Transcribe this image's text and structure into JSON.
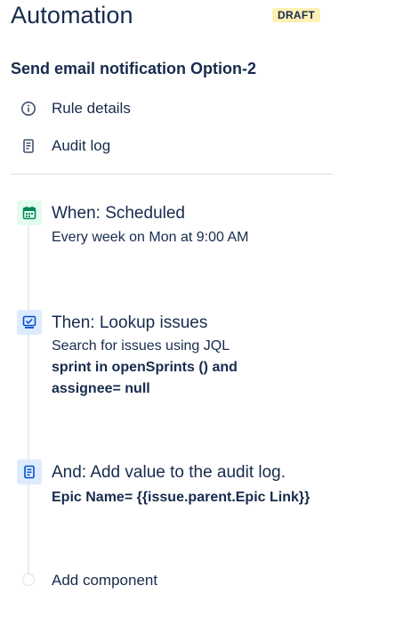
{
  "header": {
    "title": "Automation",
    "badge": "DRAFT"
  },
  "rule": {
    "name": "Send email notification Option-2"
  },
  "menu": {
    "rule_details": "Rule details",
    "audit_log": "Audit log"
  },
  "steps": [
    {
      "title": "When: Scheduled",
      "subtitle": "Every week on Mon at 9:00 AM",
      "icon": "calendar-icon"
    },
    {
      "title": "Then: Lookup issues",
      "subtitle": "Search for issues using JQL",
      "detail_line1": "sprint in openSprints () and",
      "detail_line2": "assignee= null",
      "icon": "lookup-issues-icon"
    },
    {
      "title": "And: Add value to the audit log.",
      "detail": "Epic Name= {{issue.parent.Epic Link}}",
      "icon": "audit-log-icon"
    }
  ],
  "add_component": "Add component",
  "colors": {
    "text": "#172b4d",
    "draft_badge_bg": "#fff0b3",
    "trigger_icon_bg": "#e3fcef",
    "trigger_icon": "#00875a",
    "action_icon_bg": "#deebff",
    "action_icon": "#0052cc",
    "timeline": "#ebecf0"
  }
}
